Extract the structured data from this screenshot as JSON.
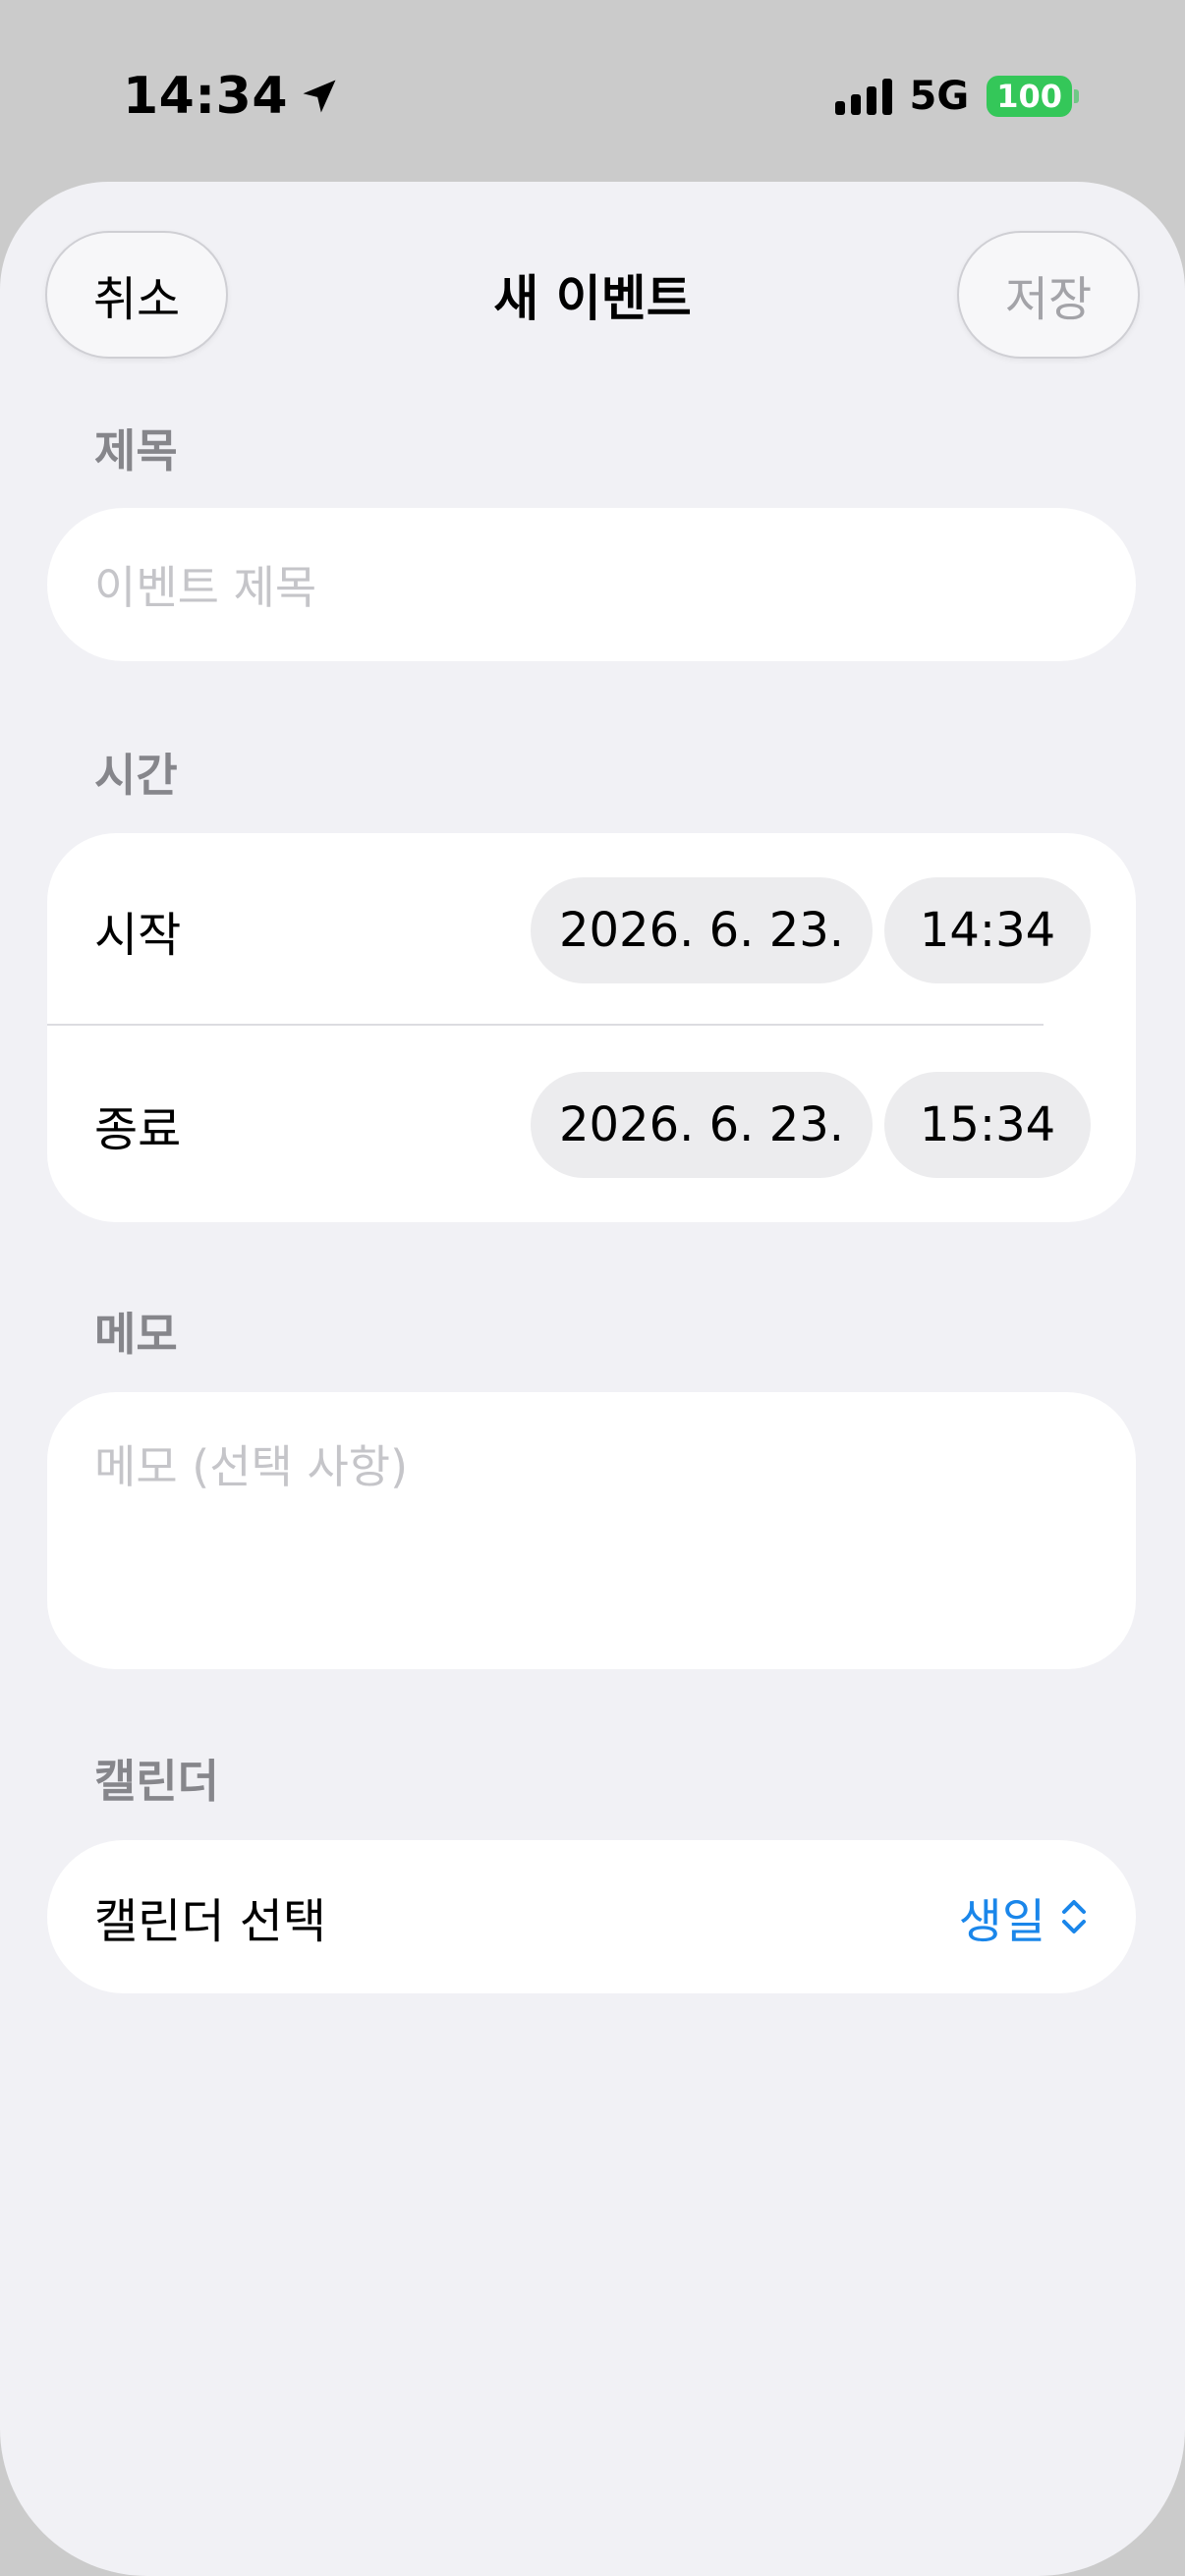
{
  "status_bar": {
    "time": "14:34",
    "network": "5G",
    "battery": "100"
  },
  "header": {
    "cancel_label": "취소",
    "title": "새 이벤트",
    "save_label": "저장"
  },
  "title_section": {
    "label": "제목",
    "placeholder": "이벤트 제목"
  },
  "time_section": {
    "label": "시간",
    "start": {
      "label": "시작",
      "date": "2026. 6. 23.",
      "time": "14:34"
    },
    "end": {
      "label": "종료",
      "date": "2026. 6. 23.",
      "time": "15:34"
    }
  },
  "memo_section": {
    "label": "메모",
    "placeholder": "메모 (선택 사항)"
  },
  "calendar_section": {
    "label": "캘린더",
    "row_label": "캘린더 선택",
    "selected": "생일"
  },
  "colors": {
    "accent": "#1a86ea",
    "battery": "#34c759",
    "sheet_bg": "#f1f1f5",
    "secondary_text": "#86868b",
    "placeholder": "#c5c5c9"
  },
  "icons": {
    "location": "location-arrow-icon",
    "signal": "cellular-signal-icon",
    "battery": "battery-icon",
    "calendar_picker": "chevron-up-down-icon"
  }
}
